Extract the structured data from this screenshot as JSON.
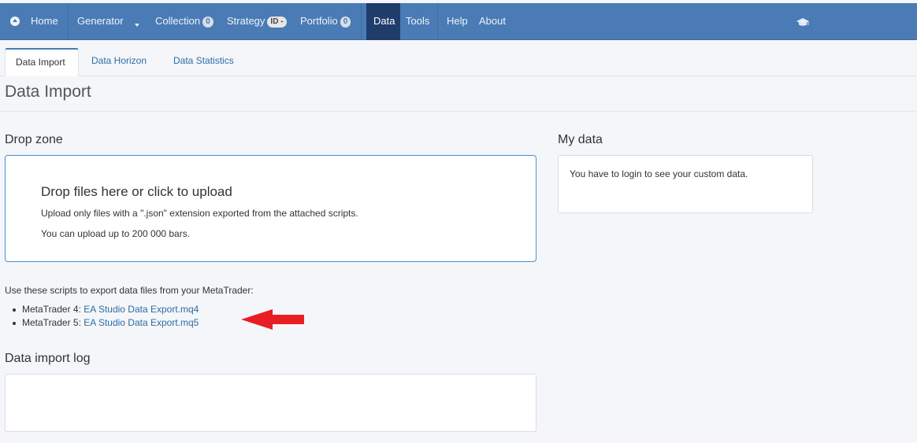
{
  "nav": {
    "home": "Home",
    "generator": "Generator",
    "collection": "Collection",
    "collection_count": "0",
    "strategy": "Strategy",
    "strategy_badge": "ID -",
    "portfolio": "Portfolio",
    "portfolio_count": "0",
    "data": "Data",
    "tools": "Tools",
    "help": "Help",
    "about": "About",
    "accent_color": "#4a7bb5",
    "active_color": "#1f3c6b"
  },
  "tabs": [
    {
      "label": "Data Import",
      "active": true
    },
    {
      "label": "Data Horizon",
      "active": false
    },
    {
      "label": "Data Statistics",
      "active": false
    }
  ],
  "page_title": "Data Import",
  "dropzone": {
    "heading": "Drop zone",
    "title": "Drop files here or click to upload",
    "line1": "Upload only files with a \".json\" extension exported from the attached scripts.",
    "line2": "You can upload up to 200 000 bars."
  },
  "my_data": {
    "heading": "My data",
    "message": "You have to login to see your custom data."
  },
  "scripts": {
    "intro": "Use these scripts to export data files from your MetaTrader:",
    "items": [
      {
        "prefix": "MetaTrader 4: ",
        "link": "EA Studio Data Export.mq4"
      },
      {
        "prefix": "MetaTrader 5: ",
        "link": "EA Studio Data Export.mq5"
      }
    ]
  },
  "log": {
    "heading": "Data import log",
    "content": ""
  },
  "icons": {
    "home": "home-circle-icon",
    "dropdown": "caret-down-icon",
    "user": "graduation-cap-icon",
    "annotation": "red-arrow-icon"
  }
}
